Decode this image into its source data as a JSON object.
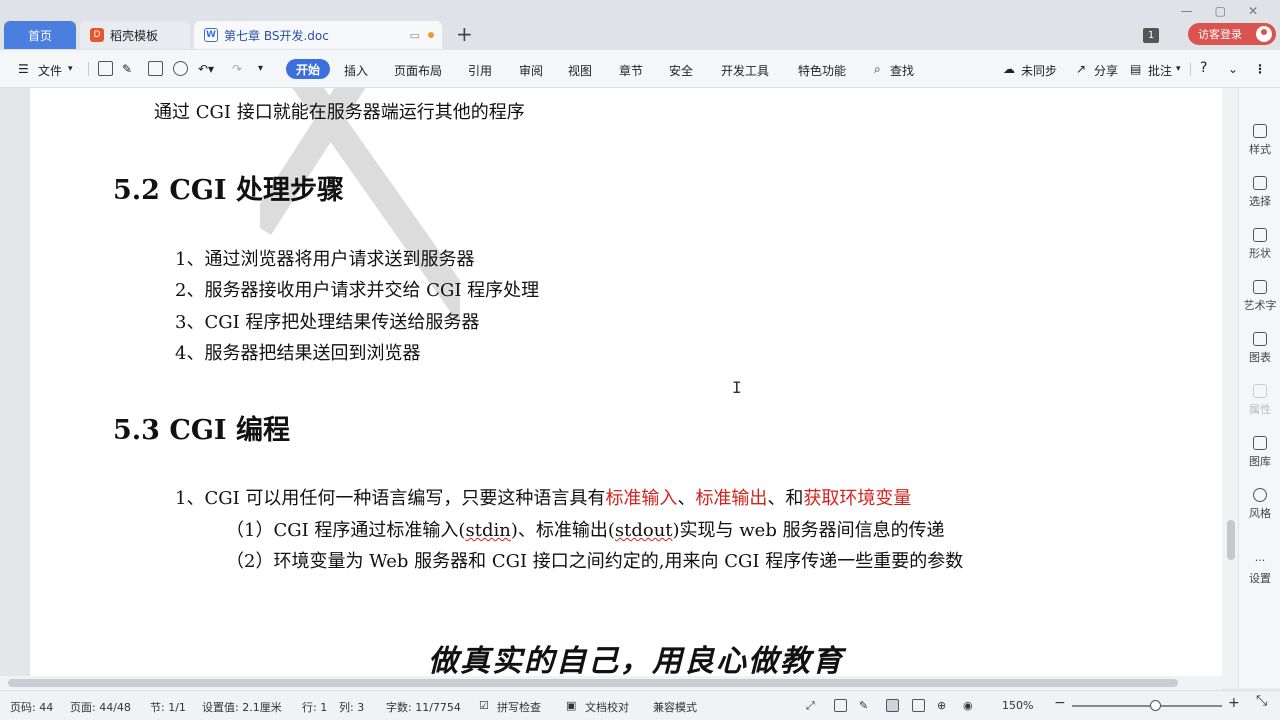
{
  "tabs": {
    "home": "首页",
    "template": "稻壳模板",
    "doc": "第七章 BS开发.doc"
  },
  "titlebar": {
    "window_count": "1",
    "login": "访客登录"
  },
  "menu": {
    "file": "文件",
    "start": "开始",
    "insert": "插入",
    "layout": "页面布局",
    "reference": "引用",
    "review": "审阅",
    "view": "视图",
    "chapter": "章节",
    "security": "安全",
    "devtools": "开发工具",
    "features": "特色功能",
    "search": "查找",
    "sync": "未同步",
    "share": "分享",
    "comment": "批注",
    "help": "?"
  },
  "document": {
    "top_line": "通过 CGI 接口就能在服务器端运行其他的程序",
    "h52": "5.2 CGI 处理步骤",
    "steps": [
      "1、通过浏览器将用户请求送到服务器",
      "2、服务器接收用户请求并交给 CGI 程序处理",
      "3、CGI 程序把处理结果传送给服务器",
      "4、服务器把结果送回到浏览器"
    ],
    "h53": "5.3 CGI 编程",
    "p1_a": "1、CGI 可以用任何一种语言编写，只要这种语言具有",
    "p1_r1": "标准输入",
    "p1_s1": "、",
    "p1_r2": "标准输出",
    "p1_s2": "、和",
    "p1_r3": "获取环境变量",
    "s1_a": "（1）CGI 程序通过标准输入(",
    "s1_w1": "stdin",
    "s1_b": ")、标准输出(",
    "s1_w2": "stdout",
    "s1_c": ")实现与 web 服务器间信息的传递",
    "s2": "（2）环境变量为 Web 服务器和 CGI 接口之间约定的,用来向 CGI 程序传递一些重要的参数",
    "slogan": "做真实的自己，用良心做教育"
  },
  "sidebar": {
    "style": "样式",
    "select": "选择",
    "shape": "形状",
    "wordart": "艺术字",
    "chart": "图表",
    "property": "属性",
    "gallery": "图库",
    "theme": "风格",
    "settings": "设置"
  },
  "status": {
    "page_code": "页码: 44",
    "pages": "页面: 44/48",
    "section": "节: 1/1",
    "setting": "设置值: 2.1厘米",
    "row": "行: 1",
    "col": "列: 3",
    "words": "字数: 11/7754",
    "spell": "拼写检查",
    "proof": "文档校对",
    "compat": "兼容模式",
    "zoom": "150%",
    "zoom_level": 0.52
  },
  "colors": {
    "accent": "#3d6fdc",
    "highlight_red": "#d6221d",
    "login_red": "#d9534f"
  }
}
